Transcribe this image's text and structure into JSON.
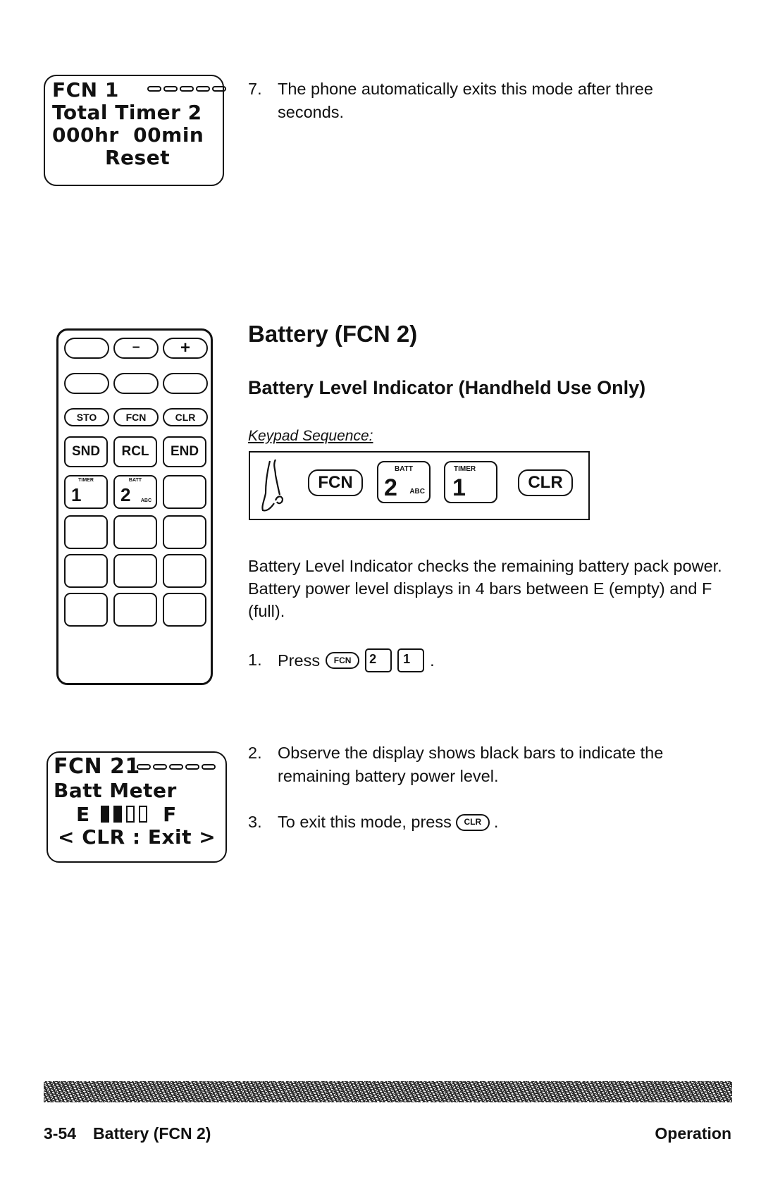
{
  "displays": {
    "total_timer": {
      "lines": [
        "FCN 1",
        "Total Timer 2",
        "000hr  00min",
        "Reset"
      ],
      "signal_bars": 5
    },
    "batt_meter": {
      "lines": [
        "FCN 21",
        "Batt Meter",
        "< CLR : Exit >"
      ],
      "meter_left": "E",
      "meter_right": "F",
      "bars_filled": 2,
      "bars_total": 4,
      "signal_bars": 5
    }
  },
  "step7": {
    "number": "7.",
    "text": "The phone automatically exits this mode after three seconds."
  },
  "section": {
    "title": "Battery (FCN 2)",
    "subtitle": "Battery Level Indicator (Handheld Use Only)",
    "keypad_sequence_label": "Keypad Sequence:",
    "keypad_sequence": [
      {
        "type": "pill",
        "label": "FCN"
      },
      {
        "type": "square",
        "sup": "BATT",
        "num": "2",
        "sub": "ABC"
      },
      {
        "type": "square",
        "sup": "TIMER",
        "num": "1",
        "sub": ""
      },
      {
        "type": "pill",
        "label": "CLR"
      }
    ],
    "description": "Battery Level Indicator checks the remaining battery pack power.  Battery power level displays in 4 bars between E (empty) and F (full).",
    "steps": [
      {
        "number": "1.",
        "text": "Press",
        "keys": [
          "FCN",
          "2",
          "1"
        ],
        "suffix": "."
      },
      {
        "number": "2.",
        "text": "Observe the display shows black bars to indicate the remaining battery power level."
      },
      {
        "number": "3.",
        "text": "To exit this mode, press",
        "key": "CLR",
        "suffix": "."
      }
    ]
  },
  "keypad": {
    "row1": [
      "",
      "−",
      "+"
    ],
    "row2": [
      "",
      "",
      ""
    ],
    "row3": [
      "STO",
      "FCN",
      "CLR"
    ],
    "row4": [
      "SND",
      "RCL",
      "END"
    ],
    "key1": {
      "sup": "TIMER",
      "num": "1"
    },
    "key2": {
      "sup": "BATT",
      "num": "2",
      "sub": "ABC"
    }
  },
  "footer": {
    "page": "3-54",
    "section": "Battery (FCN 2)",
    "chapter": "Operation"
  }
}
